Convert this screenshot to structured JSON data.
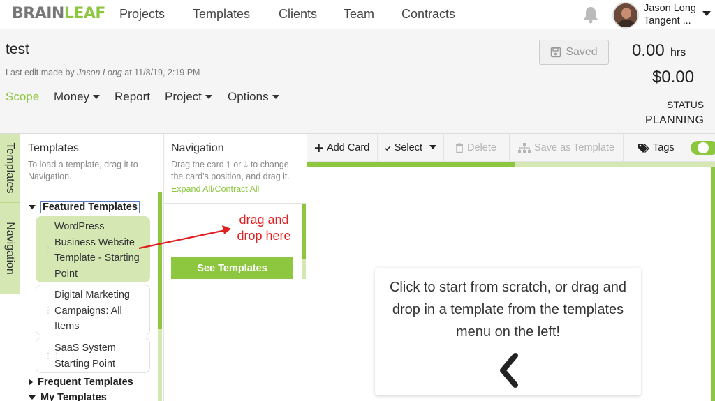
{
  "app": {
    "logo_prefix": "BRAIN",
    "logo_suffix": "LEAF"
  },
  "topnav": {
    "links": [
      "Projects",
      "Templates",
      "Clients",
      "Team",
      "Contracts"
    ],
    "user_name": "Jason Long",
    "user_org": "Tangent ..."
  },
  "project": {
    "title": "test",
    "last_edit_prefix": "Last edit made by",
    "last_edit_user": "Jason Long",
    "last_edit_time": "at 11/8/19, 2:19 PM",
    "saved_label": "Saved",
    "hours": "0.00",
    "hours_unit": "hrs",
    "money": "$0.00",
    "status_label": "STATUS",
    "status_value": "PLANNING"
  },
  "subnav": {
    "scope": "Scope",
    "money": "Money",
    "report": "Report",
    "project": "Project",
    "options": "Options"
  },
  "vertical_tabs": {
    "templates": "Templates",
    "navigation": "Navigation"
  },
  "templates_panel": {
    "title": "Templates",
    "help": "To load a template, drag it to Navigation.",
    "featured_label": "Featured Templates",
    "cards": [
      "WordPress Business Website Template - Starting Point",
      "Digital Marketing Campaigns: All Items",
      "SaaS System Starting Point"
    ],
    "frequent_label": "Frequent Templates",
    "my_label": "My Templates"
  },
  "navigation_panel": {
    "title": "Navigation",
    "help_part1": "Drag the card",
    "help_or": "or",
    "help_part2": "to change the card's position, and drag it.",
    "expand_link": "Expand All/Contract All",
    "see_templates": "See Templates",
    "annotation": "drag and drop here"
  },
  "toolbar": {
    "add_card": "Add Card",
    "select": "Select",
    "delete": "Delete",
    "save_as_template": "Save as Template",
    "tags": "Tags",
    "progress_fraction": 0.51
  },
  "canvas": {
    "message": "Click to start from scratch, or drag and drop in a template from the templates menu on the left!"
  },
  "colors": {
    "accent": "#8dc63f",
    "accent_light": "#d5e8b4",
    "annotation": "#e02020"
  }
}
